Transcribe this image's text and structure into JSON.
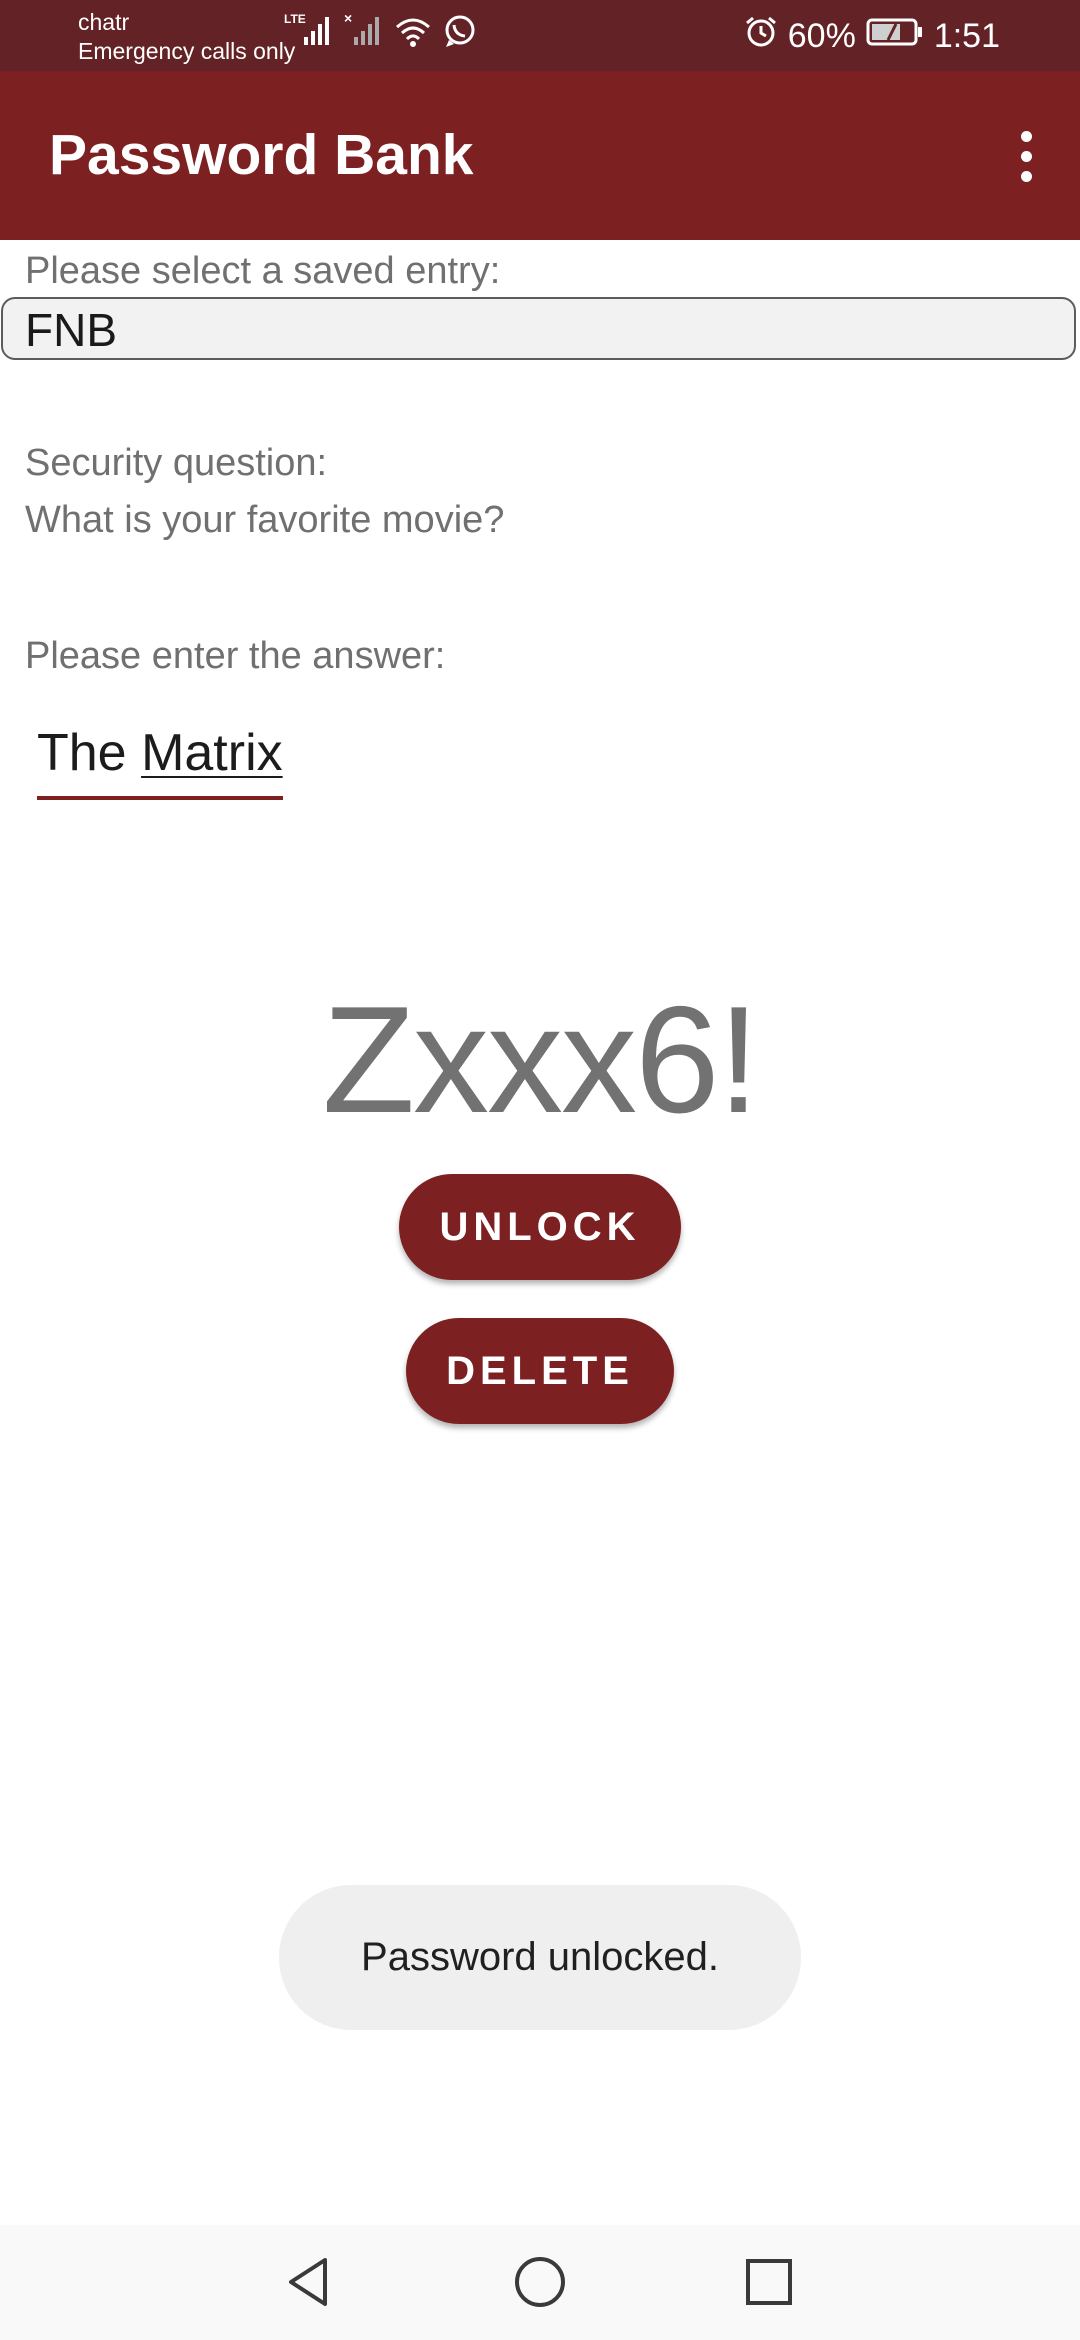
{
  "status_bar": {
    "carrier": "chatr",
    "emergency": "Emergency calls only",
    "network": "LTE",
    "battery": "60%",
    "time": "1:51",
    "icons": [
      "lte-signal-icon",
      "no-sim-signal-icon",
      "wifi-icon",
      "whatsapp-icon",
      "alarm-icon",
      "battery-icon"
    ]
  },
  "app_bar": {
    "title": "Password Bank",
    "menu_icon": "overflow-menu-icon"
  },
  "entry": {
    "label": "Please select a saved entry:",
    "selected": "FNB"
  },
  "security": {
    "label": "Security question:",
    "question": "What is your favorite movie?"
  },
  "answer": {
    "label": "Please enter the answer:",
    "word1": "The",
    "word2": "Matrix"
  },
  "password": "Zxxx6!",
  "buttons": {
    "unlock": "UNLOCK",
    "delete": "DELETE"
  },
  "toast": "Password unlocked.",
  "navigation": [
    "back-icon",
    "home-icon",
    "recents-icon"
  ],
  "colors": {
    "status_bar": "#632225",
    "app_bar": "#7c2021",
    "accent": "#7c2021"
  }
}
